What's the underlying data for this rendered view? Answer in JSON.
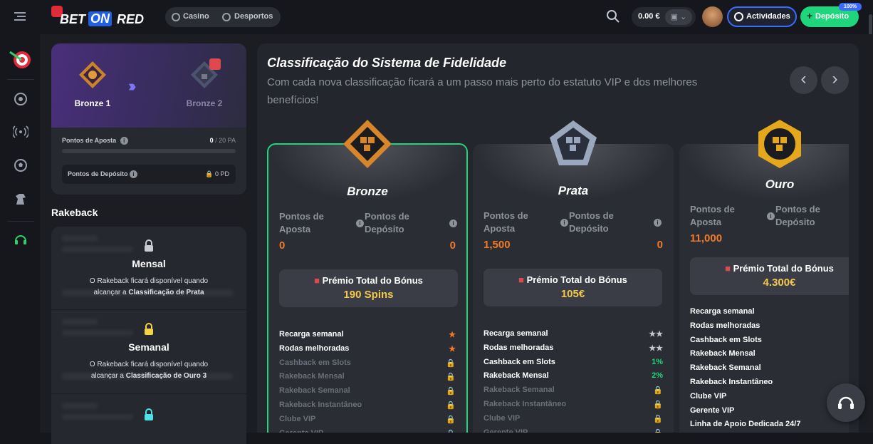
{
  "header": {
    "logo_part1": "BET",
    "logo_part2": "ON",
    "logo_part3": "RED",
    "nav": [
      {
        "label": "Casino",
        "icon": "casino-chip-icon"
      },
      {
        "label": "Desportos",
        "icon": "soccer-ball-icon"
      }
    ],
    "balance": "0.00 €",
    "activities_label": "Actividades",
    "deposit_label": "Depósito",
    "deposit_badge": "100%"
  },
  "sidebar": {
    "icons": [
      "darts-icon",
      "casino-chip-icon",
      "live-broadcast-icon",
      "soccer-ball-icon",
      "horse-icon",
      "headset-icon"
    ]
  },
  "level": {
    "current": "Bronze 1",
    "next": "Bronze 2",
    "bet_points_label": "Pontos de Aposta",
    "bet_points_value": "0",
    "bet_points_target": "/ 20 PA",
    "bet_progress": 0,
    "deposit_points_label": "Pontos de Depósito",
    "deposit_points_value": "0 PD"
  },
  "rakeback": {
    "title": "Rakeback",
    "cards": [
      {
        "name": "Mensal",
        "text": "O Rakeback ficará disponível quando",
        "text2": "alcançar a ",
        "strong": "Classificação de Prata",
        "lock_color": "#c9ccd3"
      },
      {
        "name": "Semanal",
        "text": "O Rakeback ficará disponível quando",
        "text2": "alcançar a ",
        "strong": "Classificação de Ouro 3",
        "lock_color": "#f3d34a"
      },
      {
        "name": "",
        "text": "",
        "text2": "",
        "strong": "",
        "lock_color": "#4fe0e8"
      }
    ]
  },
  "fidelity": {
    "title": "Classificação do Sistema de Fidelidade",
    "subtitle_line1": "Com cada nova classificação ficará a um passo mais perto do estatuto VIP e dos melhores",
    "subtitle_line2": "benefícios!",
    "prev": "‹",
    "next": "›",
    "bet_label_1": "Pontos de",
    "bet_label_2": "Aposta",
    "dep_label_1": "Pontos de",
    "dep_label_2": "Depósito",
    "bonus_label": "Prémio Total do Bónus",
    "tiers": [
      {
        "name": "Bronze",
        "bet": "0",
        "dep": "0",
        "bonus": "190 Spins",
        "color": "#d9862a",
        "features": [
          {
            "label": "Recarga semanal",
            "on": true,
            "mark": "★"
          },
          {
            "label": "Rodas melhoradas",
            "on": true,
            "mark": "★"
          },
          {
            "label": "Cashback em Slots",
            "on": false,
            "mark": "🔒"
          },
          {
            "label": "Rakeback Mensal",
            "on": false,
            "mark": "🔒"
          },
          {
            "label": "Rakeback Semanal",
            "on": false,
            "mark": "🔒"
          },
          {
            "label": "Rakeback Instantâneo",
            "on": false,
            "mark": "🔒"
          },
          {
            "label": "Clube VIP",
            "on": false,
            "mark": "🔒"
          },
          {
            "label": "Gerente VIP",
            "on": false,
            "mark": "🔒"
          }
        ]
      },
      {
        "name": "Prata",
        "bet": "1,500",
        "dep": "0",
        "bonus": "105€",
        "color": "#9aa7bd",
        "features": [
          {
            "label": "Recarga semanal",
            "on": true,
            "mark": "★★"
          },
          {
            "label": "Rodas melhoradas",
            "on": true,
            "mark": "★★"
          },
          {
            "label": "Cashback em Slots",
            "on": true,
            "mark": "1%"
          },
          {
            "label": "Rakeback Mensal",
            "on": true,
            "mark": "2%"
          },
          {
            "label": "Rakeback Semanal",
            "on": false,
            "mark": "🔒"
          },
          {
            "label": "Rakeback Instantâneo",
            "on": false,
            "mark": "🔒"
          },
          {
            "label": "Clube VIP",
            "on": false,
            "mark": "🔒"
          },
          {
            "label": "Gerente VIP",
            "on": false,
            "mark": "🔒"
          }
        ]
      },
      {
        "name": "Ouro",
        "bet": "11,000",
        "dep": "",
        "bonus": "4.300€",
        "color": "#e5a81c",
        "features": [
          {
            "label": "Recarga semanal",
            "on": true,
            "mark": "★"
          },
          {
            "label": "Rodas melhoradas",
            "on": true,
            "mark": "★"
          },
          {
            "label": "Cashback em Slots",
            "on": true,
            "mark": "a"
          },
          {
            "label": "Rakeback Mensal",
            "on": true,
            "mark": "a"
          },
          {
            "label": "Rakeback Semanal",
            "on": true,
            "mark": "a"
          },
          {
            "label": "Rakeback Instantâneo",
            "on": true,
            "mark": "a"
          },
          {
            "label": "Clube VIP",
            "on": true,
            "mark": ""
          },
          {
            "label": "Gerente VIP",
            "on": true,
            "mark": ""
          },
          {
            "label": "Linha de Apoio Dedicada 24/7",
            "on": true,
            "mark": ""
          }
        ]
      }
    ]
  },
  "colors": {
    "accent_green": "#1fd67c",
    "accent_blue": "#3b6bff",
    "orange": "#f07a2a",
    "gold": "#f5c84a"
  }
}
